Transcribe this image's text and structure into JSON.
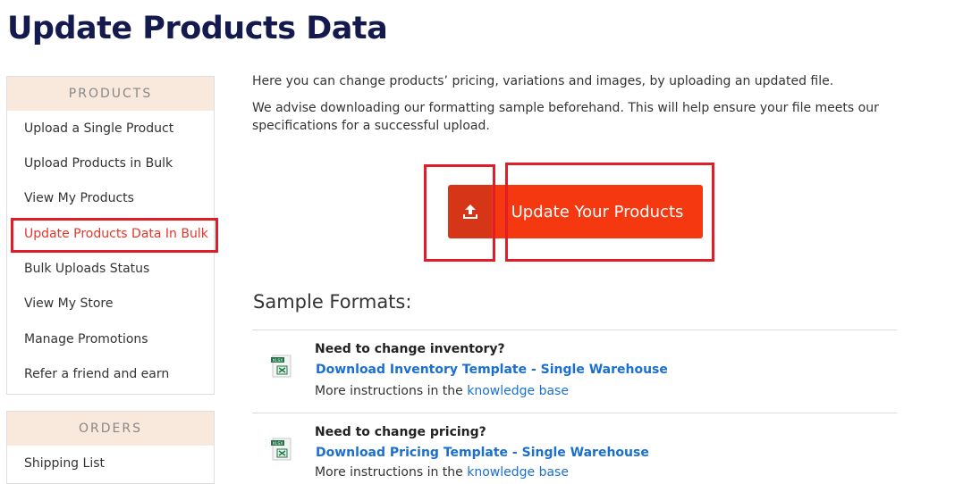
{
  "page": {
    "title": "Update Products Data"
  },
  "sidebar": {
    "products": {
      "heading": "PRODUCTS",
      "items": [
        {
          "label": "Upload a Single Product"
        },
        {
          "label": "Upload Products in Bulk"
        },
        {
          "label": "View My Products"
        },
        {
          "label": "Update Products Data In Bulk",
          "active": true
        },
        {
          "label": "Bulk Uploads Status"
        },
        {
          "label": "View My Store"
        },
        {
          "label": "Manage Promotions"
        },
        {
          "label": "Refer a friend and earn"
        }
      ]
    },
    "orders": {
      "heading": "ORDERS",
      "items": [
        {
          "label": "Shipping List"
        }
      ]
    }
  },
  "main": {
    "intro_1": "Here you can change products’ pricing, variations and images, by uploading an updated file.",
    "intro_2": "We advise downloading our formatting sample beforehand. This will help ensure your file meets our specifications for a successful upload.",
    "upload_button": {
      "label": "Update Your Products",
      "icon": "upload-icon"
    },
    "sample_formats": {
      "title": "Sample Formats:",
      "items": [
        {
          "question": "Need to change inventory?",
          "link": "Download Inventory Template - Single Warehouse",
          "more_prefix": "More instructions in the",
          "more_link": "knowledge base",
          "icon": "xlsx-file-icon"
        },
        {
          "question": "Need to change pricing?",
          "link": "Download Pricing Template - Single Warehouse",
          "more_prefix": "More instructions in the",
          "more_link": "knowledge base",
          "icon": "xlsx-file-icon"
        }
      ]
    }
  },
  "colors": {
    "title": "#141a4e",
    "accent": "#f63811",
    "accent_dark": "#d63617",
    "link": "#1a6fd0",
    "highlight": "#e01e2a",
    "panel_head_bg": "#f9e8dc"
  }
}
